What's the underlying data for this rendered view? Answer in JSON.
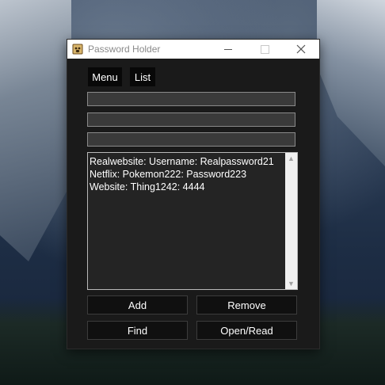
{
  "window": {
    "title": "Password Holder",
    "controls": {
      "minimize": "—",
      "maximize": "☐",
      "close": "✕"
    }
  },
  "menu": {
    "items": [
      "Menu",
      "List"
    ]
  },
  "fields": [
    {
      "value": "",
      "placeholder": ""
    },
    {
      "value": "",
      "placeholder": ""
    },
    {
      "value": "",
      "placeholder": ""
    }
  ],
  "list": {
    "lines": [
      "Realwebsite: Username: Realpassword21",
      "Netflix: Pokemon222: Password223",
      "Website: Thing1242: 4444"
    ]
  },
  "buttons": {
    "add": "Add",
    "remove": "Remove",
    "find": "Find",
    "open": "Open/Read"
  },
  "icons": {
    "app": "pawprint-notebook-icon",
    "scroll_up": "scroll-up-arrow-icon",
    "scroll_down": "scroll-down-arrow-icon"
  },
  "colors": {
    "window_bg": "#1a1a1a",
    "title_bar": "#ffffff",
    "field_bg": "#3a3a3a",
    "list_bg": "#242424"
  }
}
